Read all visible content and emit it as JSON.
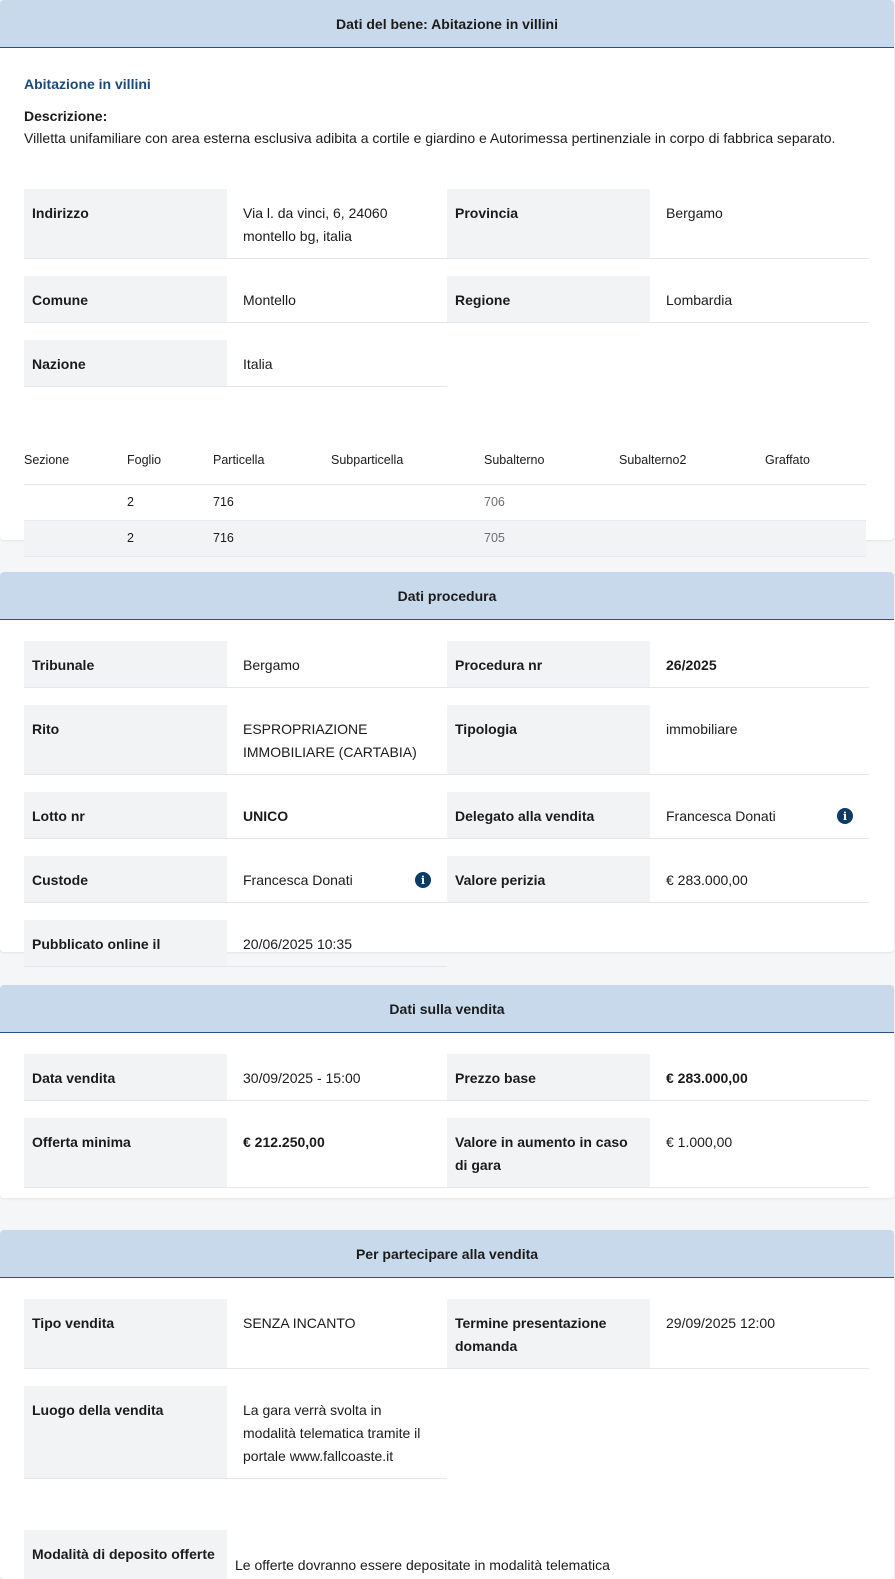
{
  "bene": {
    "header": "Dati del bene: Abitazione in villini",
    "subtitle": "Abitazione in villini",
    "descrizione_label": "Descrizione:",
    "descrizione": "Villetta unifamiliare con area esterna esclusiva adibita a cortile e giardino e Autorimessa pertinenziale in corpo di fabbrica separato.",
    "fields": {
      "indirizzo_label": "Indirizzo",
      "indirizzo": "Via l. da vinci, 6, 24060 montello bg, italia",
      "provincia_label": "Provincia",
      "provincia": "Bergamo",
      "comune_label": "Comune",
      "comune": "Montello",
      "regione_label": "Regione",
      "regione": "Lombardia",
      "nazione_label": "Nazione",
      "nazione": "Italia"
    },
    "catasto": {
      "headers": [
        "Sezione",
        "Foglio",
        "Particella",
        "Subparticella",
        "Subalterno",
        "Subalterno2",
        "Graffato"
      ],
      "rows": [
        [
          "",
          "2",
          "716",
          "",
          "706",
          "",
          ""
        ],
        [
          "",
          "2",
          "716",
          "",
          "705",
          "",
          ""
        ]
      ]
    }
  },
  "procedura": {
    "header": "Dati procedura",
    "tribunale_label": "Tribunale",
    "tribunale": "Bergamo",
    "procedura_nr_label": "Procedura nr",
    "procedura_nr": "26/2025",
    "rito_label": "Rito",
    "rito": "ESPROPRIAZIONE IMMOBILIARE (CARTABIA)",
    "tipologia_label": "Tipologia",
    "tipologia": "immobiliare",
    "lotto_label": "Lotto nr",
    "lotto": "UNICO",
    "delegato_label": "Delegato alla vendita",
    "delegato": "Francesca Donati",
    "custode_label": "Custode",
    "custode": "Francesca Donati",
    "valore_perizia_label": "Valore perizia",
    "valore_perizia": "€ 283.000,00",
    "pubblicato_label": "Pubblicato online il",
    "pubblicato": "20/06/2025 10:35",
    "info_icon": "info-icon"
  },
  "vendita": {
    "header": "Dati sulla vendita",
    "data_label": "Data vendita",
    "data": "30/09/2025 - 15:00",
    "prezzo_label": "Prezzo base",
    "prezzo": "€ 283.000,00",
    "offerta_label": "Offerta minima",
    "offerta": "€ 212.250,00",
    "aumento_label": "Valore in aumento in caso di gara",
    "aumento": "€ 1.000,00"
  },
  "partecipare": {
    "header": "Per partecipare alla vendita",
    "tipo_label": "Tipo vendita",
    "tipo": "SENZA INCANTO",
    "termine_label": "Termine presentazione domanda",
    "termine": "29/09/2025 12:00",
    "luogo_label": "Luogo della vendita",
    "luogo": "La gara verrà svolta in modalità telematica tramite il portale www.fallcoaste.it",
    "modalita_label": "Modalità di deposito offerte",
    "modalita": "Le offerte dovranno essere depositate in modalità telematica"
  },
  "colors": {
    "header_bg": "#c8d9ec",
    "header_border": "#2a5185",
    "label_bg": "#f2f3f5",
    "accent_text": "#1b4a7a"
  }
}
